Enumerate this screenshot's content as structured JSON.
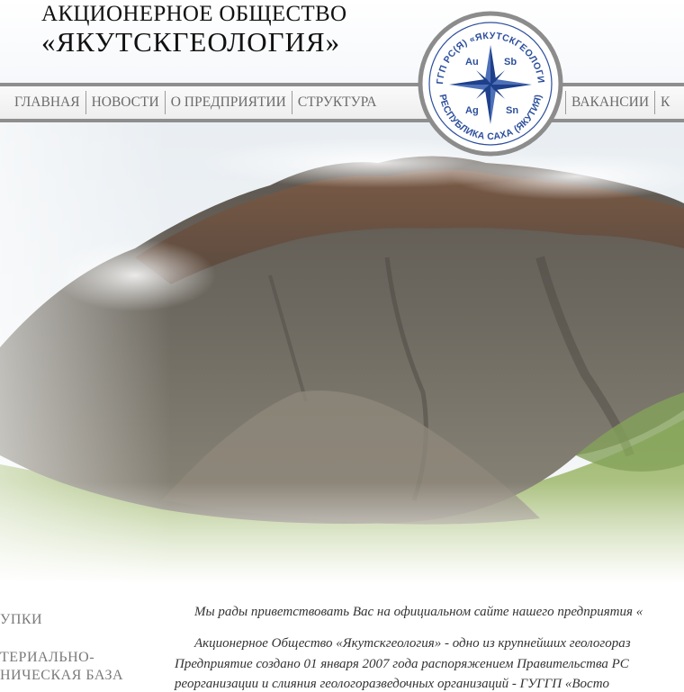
{
  "header": {
    "company_line1": "АКЦИОНЕРНОЕ ОБЩЕСТВО",
    "company_line2": "«ЯКУТСКГЕОЛОГИЯ»"
  },
  "nav": {
    "items_left": [
      "ГЛАВНАЯ",
      "НОВОСТИ",
      "О ПРЕДПРИЯТИИ",
      "СТРУКТУРА"
    ],
    "items_right": [
      "ВАКАНСИИ",
      "К"
    ]
  },
  "emblem": {
    "ring_top_text": "ГУГГП РС(Я) «ЯКУТСКГЕОЛОГИЯ»",
    "ring_bottom_text": "РЕСПУБЛИКА САХА (ЯКУТИЯ)",
    "symbols": [
      "Au",
      "Sb",
      "Ag",
      "Sn"
    ],
    "colors": {
      "ring": "#8c8c8c",
      "text": "#2c4f9c",
      "star": "#1e3f8a"
    }
  },
  "sidebar": {
    "item1": "УПКИ",
    "item2_line1": "ТЕРИАЛЬНО-",
    "item2_line2": "НИЧЕСКАЯ БАЗА"
  },
  "content": {
    "welcome": "Мы рады приветствовать Вас на официальном сайте нашего предприятия «",
    "para_line1": "Акционерное Общество «Якутскгеология» - одно из крупнейших геологораз",
    "para_line2": "Предприятие создано 01 января 2007 года распоряжением Правительства РС",
    "para_line3": "реорганизации и слияния геологоразведочных организаций - ГУГГП «Восто"
  }
}
